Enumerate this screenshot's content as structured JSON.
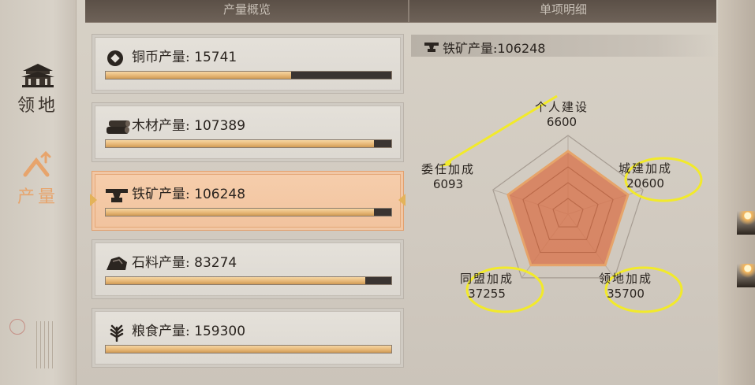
{
  "header": {
    "left_tab": "产量概览",
    "right_tab": "单项明细"
  },
  "nav": {
    "territory_label": "领地",
    "production_label": "产量"
  },
  "resources": [
    {
      "label": "铜币产量:",
      "value": "15741",
      "fill": 0.65,
      "icon": "copper-coin-icon"
    },
    {
      "label": "木材产量:",
      "value": "107389",
      "fill": 0.94,
      "icon": "wood-log-icon"
    },
    {
      "label": "铁矿产量:",
      "value": "106248",
      "fill": 0.94,
      "icon": "anvil-icon",
      "selected": true
    },
    {
      "label": "石料产量:",
      "value": "83274",
      "fill": 0.91,
      "icon": "stone-icon"
    },
    {
      "label": "粮食产量:",
      "value": "159300",
      "fill": 1.0,
      "icon": "wheat-icon"
    }
  ],
  "detail": {
    "title_label": "铁矿产量:",
    "title_value": "106248",
    "icon": "anvil-icon",
    "radar": [
      {
        "name": "个人建设",
        "value": "6600"
      },
      {
        "name": "城建加成",
        "value": "20600"
      },
      {
        "name": "领地加成",
        "value": "35700"
      },
      {
        "name": "同盟加成",
        "value": "37255"
      },
      {
        "name": "委任加成",
        "value": "6093"
      }
    ]
  },
  "colors": {
    "accent": "#e8a46e",
    "radar_fill": "#d8764f",
    "highlight": "#f2ea2a",
    "bar_fill": "#e5b574"
  }
}
